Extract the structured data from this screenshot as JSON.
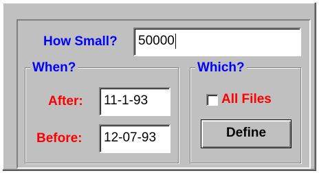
{
  "how_small": {
    "label": "How Small?",
    "value": "50000"
  },
  "when": {
    "legend": "When?",
    "after_label": "After:",
    "after_value": "11-1-93",
    "before_label": "Before:",
    "before_value": "12-07-93"
  },
  "which": {
    "legend": "Which?",
    "all_files_label": "All Files",
    "all_files_checked": false,
    "define_label": "Define"
  },
  "colors": {
    "label_blue": "#0000ff",
    "label_red": "#ff0000",
    "panel_gray": "#c0c0c0"
  }
}
